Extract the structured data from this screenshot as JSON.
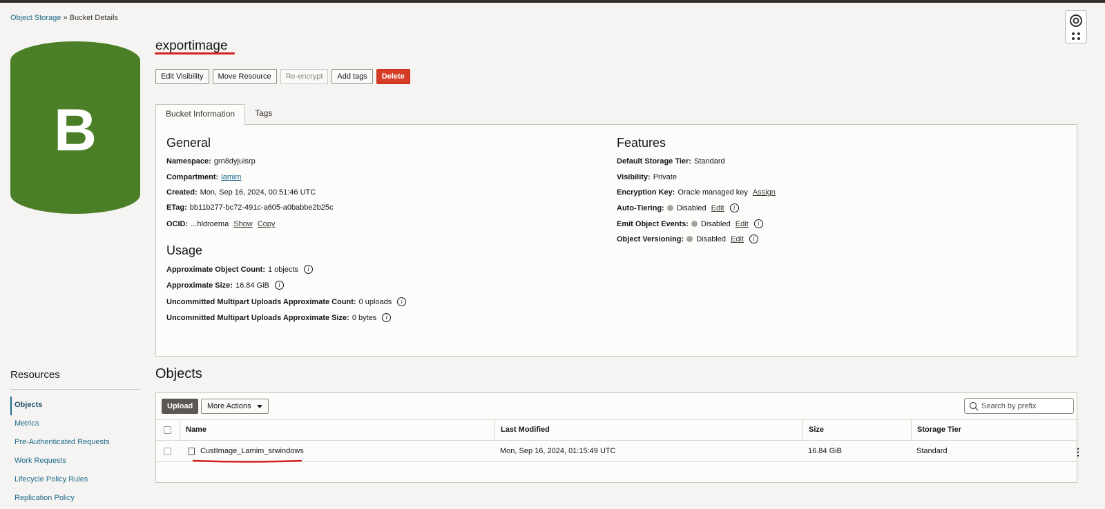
{
  "breadcrumb": {
    "root": "Object Storage",
    "separator": "»",
    "current": "Bucket Details"
  },
  "bucket": {
    "icon_letter": "B",
    "name": "exportimage",
    "icon_color": "#4b7f27"
  },
  "actions": {
    "edit_visibility": "Edit Visibility",
    "move_resource": "Move Resource",
    "reencrypt": "Re-encrypt",
    "add_tags": "Add tags",
    "delete": "Delete"
  },
  "tabs": {
    "bucket_info": "Bucket Information",
    "tags": "Tags"
  },
  "general": {
    "heading": "General",
    "namespace_label": "Namespace:",
    "namespace_value": "grn8dyjuisrp",
    "compartment_label": "Compartment:",
    "compartment_value": "lamim",
    "created_label": "Created:",
    "created_value": "Mon, Sep 16, 2024, 00:51:46 UTC",
    "etag_label": "ETag:",
    "etag_value": "bb11b277-bc72-491c-a605-a0babbe2b25c",
    "ocid_label": "OCID:",
    "ocid_value": "...hldroema",
    "show_link": "Show",
    "copy_link": "Copy"
  },
  "usage": {
    "heading": "Usage",
    "count_label": "Approximate Object Count:",
    "count_value": "1 objects",
    "size_label": "Approximate Size:",
    "size_value": "16.84 GiB",
    "multipart_count_label": "Uncommitted Multipart Uploads Approximate Count:",
    "multipart_count_value": "0 uploads",
    "multipart_size_label": "Uncommitted Multipart Uploads Approximate Size:",
    "multipart_size_value": "0 bytes"
  },
  "features": {
    "heading": "Features",
    "tier_label": "Default Storage Tier:",
    "tier_value": "Standard",
    "visibility_label": "Visibility:",
    "visibility_value": "Private",
    "encryption_label": "Encryption Key:",
    "encryption_value": "Oracle managed key",
    "assign_link": "Assign",
    "autotier_label": "Auto-Tiering:",
    "autotier_value": "Disabled",
    "events_label": "Emit Object Events:",
    "events_value": "Disabled",
    "versioning_label": "Object Versioning:",
    "versioning_value": "Disabled",
    "edit_link": "Edit"
  },
  "resources": {
    "title": "Resources",
    "items": [
      "Objects",
      "Metrics",
      "Pre-Authenticated Requests",
      "Work Requests",
      "Lifecycle Policy Rules",
      "Replication Policy"
    ]
  },
  "objects": {
    "title": "Objects",
    "upload": "Upload",
    "more_actions": "More Actions",
    "search_placeholder": "Search by prefix",
    "columns": [
      "Name",
      "Last Modified",
      "Size",
      "Storage Tier"
    ],
    "rows": [
      {
        "name": "CustImage_Lamim_srwindows",
        "last_modified": "Mon, Sep 16, 2024, 01:15:49 UTC",
        "size": "16.84 GiB",
        "tier": "Standard"
      }
    ]
  },
  "colors": {
    "accent": "#1d6a8a",
    "danger": "#d63b25",
    "annotation": "#d61f1f",
    "bucket_green": "#4b7f27"
  }
}
